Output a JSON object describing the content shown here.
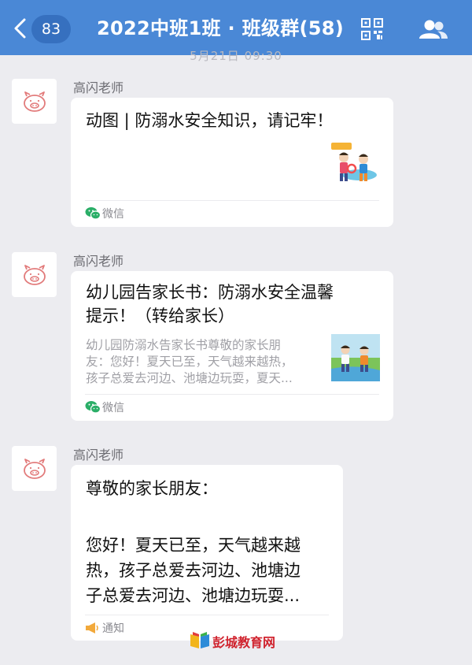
{
  "header": {
    "badge_count": "83",
    "title": "2022中班1班 · 班级群(58)"
  },
  "timestamp": "5月21日 09:30",
  "messages": [
    {
      "sender": "高闪老师",
      "title": "动图 | 防溺水安全知识，请记牢！",
      "source": "微信"
    },
    {
      "sender": "高闪老师",
      "title_lines": [
        "幼儿园告家长书：防溺水安全温馨",
        "提示！（转给家长）"
      ],
      "desc_lines": [
        "幼儿园防溺水告家长书尊敬的家长朋",
        "友：您好！夏天已至，天气越来越热，",
        "孩子总爱去河边、池塘边玩耍，夏天..."
      ],
      "source": "微信"
    },
    {
      "sender": "高闪老师",
      "lines": [
        "尊敬的家长朋友：",
        "",
        "您好！夏天已至，天气越来越",
        "热，孩子总爱去河边、池塘边",
        "子总爱去河边、池塘边玩耍..."
      ],
      "source": "通知"
    }
  ],
  "watermark": {
    "text": "彭城教育网"
  },
  "colors": {
    "header_bg": "#4a88d6",
    "badge_bg": "#3670bf",
    "page_bg": "#ececf0",
    "avatar_pig": "#e27b7b",
    "wechat_green": "#2aae67"
  },
  "icons": [
    "back-arrow-icon",
    "qr-code-icon",
    "members-icon",
    "pig-avatar-icon",
    "wechat-icon",
    "megaphone-icon"
  ]
}
